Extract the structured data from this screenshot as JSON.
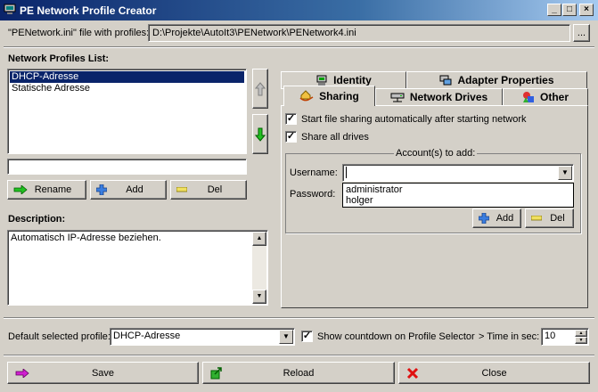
{
  "window": {
    "title": "PE Network Profile Creator"
  },
  "file": {
    "label": "\"PENetwork.ini\" file with profiles:",
    "path": "D:\\Projekte\\AutoIt3\\PENetwork\\PENetwork4.ini",
    "browse_label": "..."
  },
  "profiles": {
    "heading": "Network Profiles List:",
    "items": [
      "DHCP-Adresse",
      "Statische Adresse"
    ],
    "selected": "DHCP-Adresse",
    "name_input": "",
    "rename_label": "Rename",
    "add_label": "Add",
    "del_label": "Del"
  },
  "description": {
    "heading": "Description:",
    "text": "Automatisch IP-Adresse beziehen."
  },
  "tabs": {
    "row_back": [
      {
        "label": "Identity"
      },
      {
        "label": "Adapter Properties"
      }
    ],
    "row_front": [
      {
        "label": "Sharing"
      },
      {
        "label": "Network Drives"
      },
      {
        "label": "Other"
      }
    ],
    "active": "Sharing"
  },
  "sharing": {
    "auto_share_label": "Start file sharing automatically after starting network",
    "auto_share_checked": true,
    "share_all_label": "Share all drives",
    "share_all_checked": true,
    "accounts_group": "Account(s) to add:",
    "username_label": "Username:",
    "username_value": "",
    "password_label": "Password:",
    "dropdown_options": [
      "administrator",
      "holger"
    ],
    "add_label": "Add",
    "del_label": "Del"
  },
  "bottom": {
    "default_label": "Default selected profile:",
    "default_value": "DHCP-Adresse",
    "countdown_label": "Show countdown on Profile Selector",
    "countdown_checked": true,
    "time_label": "> Time in sec:",
    "time_value": "10",
    "save_label": "Save",
    "reload_label": "Reload",
    "close_label": "Close"
  },
  "colors": {
    "title_start": "#0a246a",
    "title_end": "#a6caf0",
    "selection": "#0a246a",
    "face": "#d4d0c8"
  }
}
